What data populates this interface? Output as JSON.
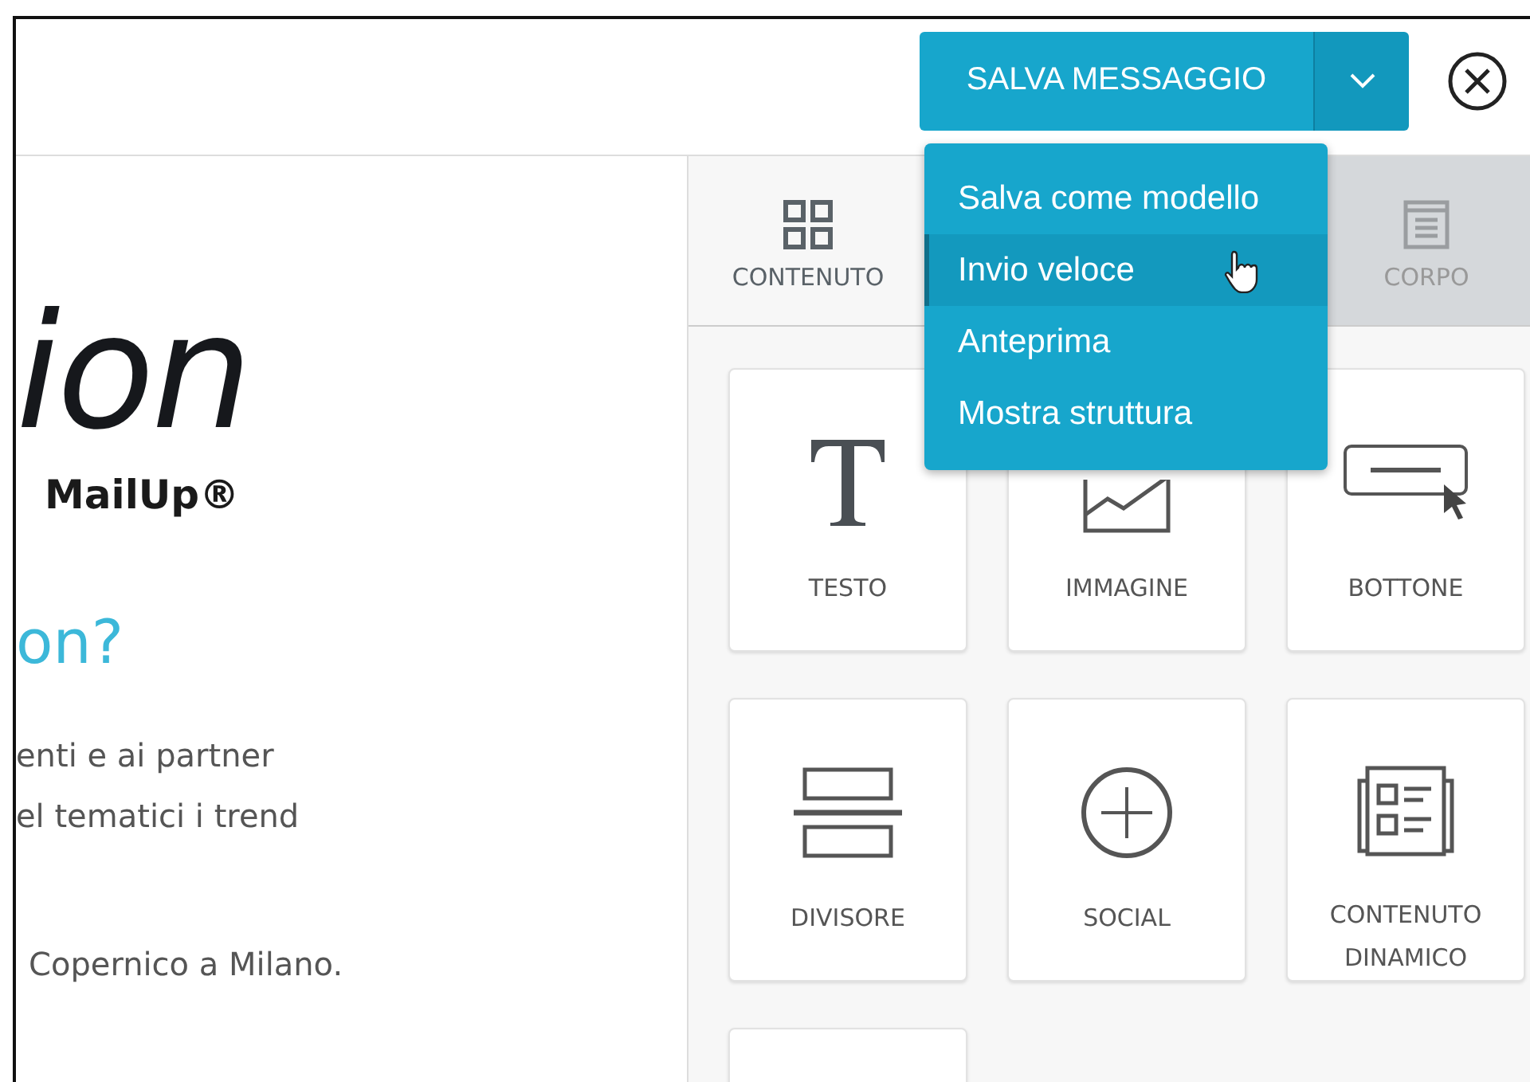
{
  "toolbar": {
    "save_button": "SALVA MESSAGGIO",
    "dropdown_open": true
  },
  "menu": [
    {
      "label": "Salva come modello",
      "highlighted": false
    },
    {
      "label": "Invio veloce",
      "highlighted": true
    },
    {
      "label": "Anteprima",
      "highlighted": false
    },
    {
      "label": "Mostra struttura",
      "highlighted": false
    }
  ],
  "preview": {
    "logo_word": "ion",
    "logo_brand": "MailUp®",
    "heading": "on?",
    "paragraph_lines": [
      "enti e ai partner",
      "el tematici i trend"
    ],
    "footer_line": "Copernico a Milano."
  },
  "panel": {
    "tabs": [
      {
        "label": "CONTENUTO",
        "kind": "grid",
        "selected": true
      },
      {
        "label": "CORPO",
        "kind": "page",
        "selected": false
      }
    ],
    "blocks": [
      {
        "kind": "text",
        "label": "TESTO"
      },
      {
        "kind": "image",
        "label": "IMMAGINE"
      },
      {
        "kind": "button",
        "label": "BOTTONE"
      },
      {
        "kind": "divider",
        "label": "DIVISORE"
      },
      {
        "kind": "social",
        "label": "SOCIAL"
      },
      {
        "kind": "dynamic",
        "label": "CONTENUTO DINAMICO"
      },
      {
        "kind": "blank"
      }
    ]
  }
}
